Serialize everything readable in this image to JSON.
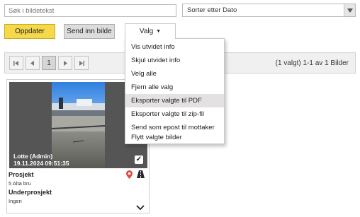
{
  "search": {
    "placeholder": "Søk i bildetekst"
  },
  "sort": {
    "selected": "Sorter etter Dato"
  },
  "toolbar": {
    "update_label": "Oppdater",
    "send_label": "Send inn bilde",
    "valg_label": "Valg"
  },
  "pagination": {
    "current_page": "1",
    "summary": "(1 valgt) 1-1 av 1 Bilder"
  },
  "menu": {
    "items": [
      "Vis utvidet info",
      "Skjul utvidet info",
      "Velg alle",
      "Fjern alle valg",
      "Eksporter valgte til PDF",
      "Eksporter valgte til zip-fil",
      "Send som epost til mottaker",
      "Flytt valgte bilder"
    ],
    "hovered_item": "Eksporter valgte til PDF"
  },
  "photo": {
    "author": "Lotte (Admin)",
    "datetime": "19.11.2024 09:51:35",
    "selected": true,
    "project_label": "Prosjekt",
    "project_value": "5 Alta bru",
    "subproject_label": "Underprosjekt",
    "subproject_value": "Ingen"
  },
  "colors": {
    "update_button": "#f6d94a",
    "location_pin": "#e04a3f",
    "menu_hover": "#e3e1e1"
  },
  "icons": [
    "first-page-icon",
    "prev-page-icon",
    "next-page-icon",
    "last-page-icon",
    "location-pin-icon",
    "road-icon",
    "chevron-down-icon",
    "dropdown-arrow-icon",
    "checkmark-icon"
  ]
}
